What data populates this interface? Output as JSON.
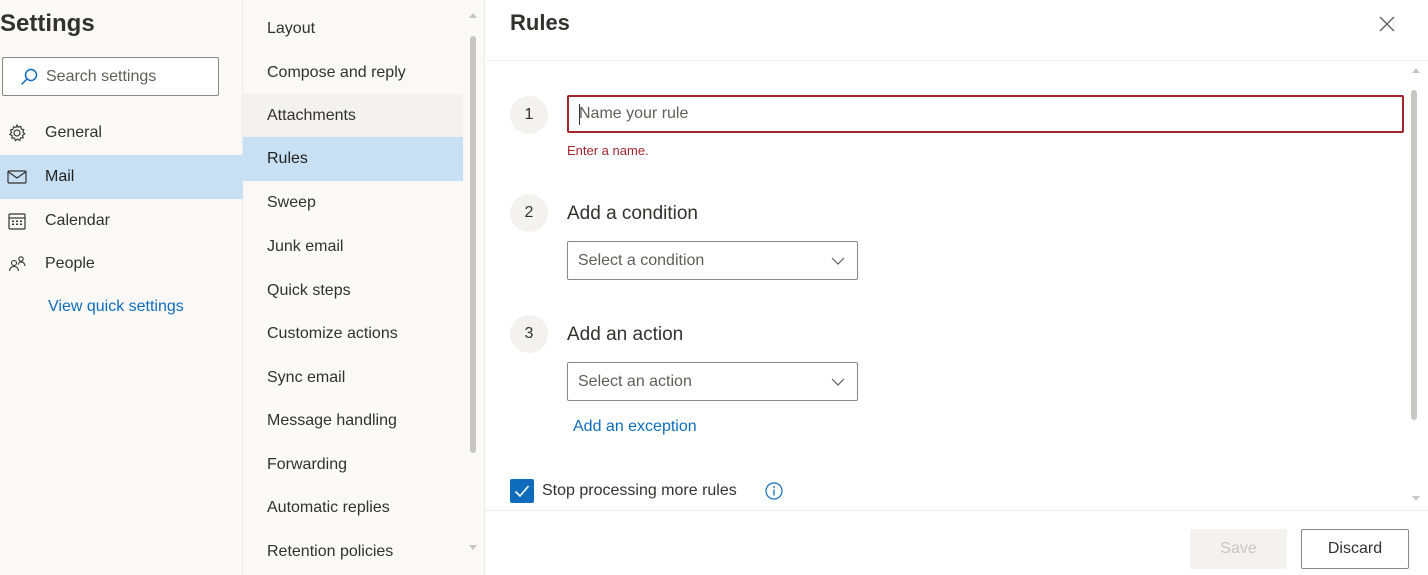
{
  "left_nav": {
    "title": "Settings",
    "search_placeholder": "Search settings",
    "items": [
      {
        "label": "General",
        "icon": "gear-icon"
      },
      {
        "label": "Mail",
        "icon": "mail-icon",
        "selected": true
      },
      {
        "label": "Calendar",
        "icon": "calendar-icon"
      },
      {
        "label": "People",
        "icon": "people-icon"
      }
    ],
    "quick_settings_link": "View quick settings"
  },
  "categories": {
    "items": [
      {
        "label": "Layout"
      },
      {
        "label": "Compose and reply"
      },
      {
        "label": "Attachments",
        "hover": true
      },
      {
        "label": "Rules",
        "selected": true
      },
      {
        "label": "Sweep"
      },
      {
        "label": "Junk email"
      },
      {
        "label": "Quick steps"
      },
      {
        "label": "Customize actions"
      },
      {
        "label": "Sync email"
      },
      {
        "label": "Message handling"
      },
      {
        "label": "Forwarding"
      },
      {
        "label": "Automatic replies"
      },
      {
        "label": "Retention policies"
      }
    ]
  },
  "rules_panel": {
    "title": "Rules",
    "close_icon": "close-icon",
    "step1": {
      "number": "1",
      "name_placeholder": "Name your rule",
      "name_value": "",
      "error": "Enter a name."
    },
    "step2": {
      "number": "2",
      "label": "Add a condition",
      "dropdown_placeholder": "Select a condition"
    },
    "step3": {
      "number": "3",
      "label": "Add an action",
      "dropdown_placeholder": "Select an action"
    },
    "add_exception_link": "Add an exception",
    "stop_processing": {
      "label": "Stop processing more rules",
      "checked": true
    },
    "footer": {
      "save_label": "Save",
      "discard_label": "Discard"
    }
  },
  "colors": {
    "accent": "#0f6cbd",
    "selected_bg": "#c7e0f4",
    "error": "#a4262c"
  }
}
